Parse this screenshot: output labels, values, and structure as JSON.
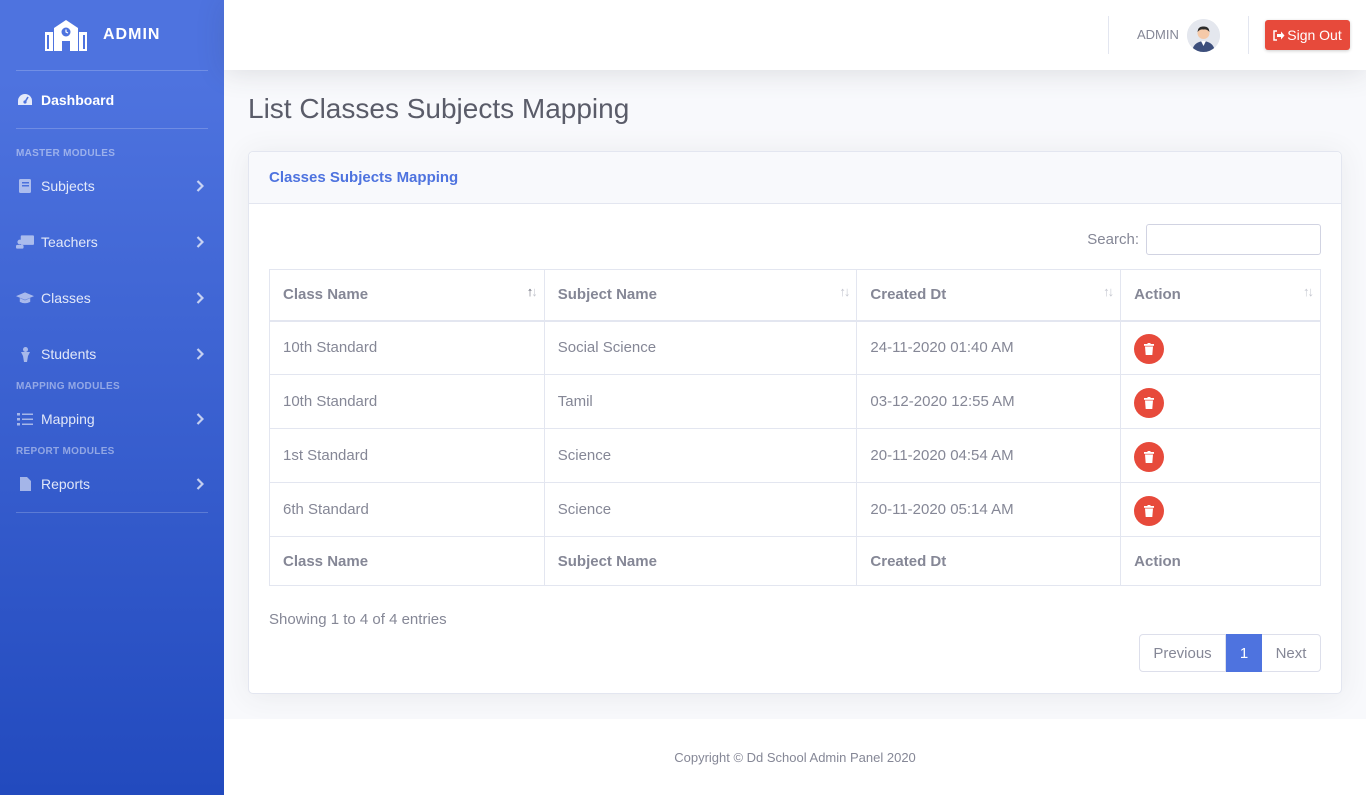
{
  "brand": {
    "name": "ADMIN",
    "icon": "school-icon"
  },
  "sidebar": {
    "dashboard": {
      "label": "Dashboard",
      "icon": "tachometer-icon"
    },
    "headings": {
      "master": "MASTER MODULES",
      "mapping": "MAPPING MODULES",
      "report": "REPORT MODULES"
    },
    "items": [
      {
        "label": "Subjects",
        "icon": "book-icon"
      },
      {
        "label": "Teachers",
        "icon": "chalkboard-teacher-icon"
      },
      {
        "label": "Classes",
        "icon": "graduation-cap-icon"
      },
      {
        "label": "Students",
        "icon": "user-icon"
      },
      {
        "label": "Mapping",
        "icon": "tasks-icon"
      },
      {
        "label": "Reports",
        "icon": "file-icon"
      }
    ]
  },
  "topbar": {
    "user_name": "ADMIN",
    "signout_label": "Sign Out"
  },
  "page": {
    "title": "List Classes Subjects Mapping"
  },
  "card": {
    "title": "Classes Subjects Mapping",
    "search_label": "Search:",
    "search_value": "",
    "columns": [
      "Class Name",
      "Subject Name",
      "Created Dt",
      "Action"
    ],
    "rows": [
      {
        "class_name": "10th Standard",
        "subject_name": "Social Science",
        "created": "24-11-2020 01:40 AM"
      },
      {
        "class_name": "10th Standard",
        "subject_name": "Tamil",
        "created": "03-12-2020 12:55 AM"
      },
      {
        "class_name": "1st Standard",
        "subject_name": "Science",
        "created": "20-11-2020 04:54 AM"
      },
      {
        "class_name": "6th Standard",
        "subject_name": "Science",
        "created": "20-11-2020 05:14 AM"
      }
    ],
    "info": "Showing 1 to 4 of 4 entries",
    "pager": {
      "previous": "Previous",
      "current": "1",
      "next": "Next"
    }
  },
  "footer": {
    "text": "Copyright © Dd School Admin Panel 2020"
  },
  "colors": {
    "primary": "#4e73df",
    "danger": "#e74a3b",
    "text": "#858796"
  }
}
